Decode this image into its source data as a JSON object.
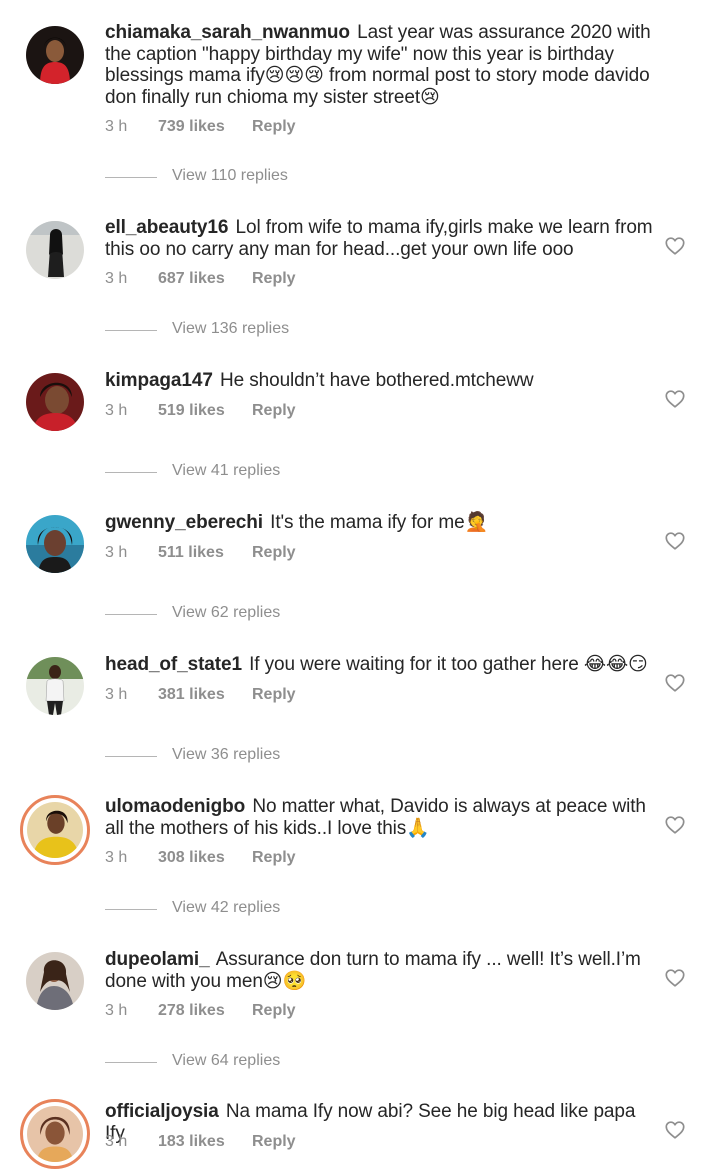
{
  "comments": [
    {
      "username": "chiamaka_sarah_nwanmuo",
      "text": "Last year was assurance 2020 with the caption \"happy birthday my wife\" now this year is birthday blessings mama ify😢😢😢 from normal post to story mode davido don finally run chioma my sister street😢",
      "time": "3 h",
      "likes": "739 likes",
      "reply": "Reply",
      "view_replies": "View 110 replies",
      "heart_visible": false
    },
    {
      "username": "ell_abeauty16",
      "text": "Lol from wife to mama ify,girls make we learn from this oo no carry any man for head...get your own life ooo",
      "time": "3 h",
      "likes": "687 likes",
      "reply": "Reply",
      "view_replies": "View 136 replies",
      "heart_visible": true
    },
    {
      "username": "kimpaga147",
      "text": "He shouldn’t have bothered.mtcheww",
      "time": "3 h",
      "likes": "519 likes",
      "reply": "Reply",
      "view_replies": "View 41 replies",
      "heart_visible": true
    },
    {
      "username": "gwenny_eberechi",
      "text": "It's the mama ify for me🤦",
      "time": "3 h",
      "likes": "511 likes",
      "reply": "Reply",
      "view_replies": "View 62 replies",
      "heart_visible": true
    },
    {
      "username": "head_of_state1",
      "text": "If you were waiting for it too gather here 😂😂😏",
      "time": "3 h",
      "likes": "381 likes",
      "reply": "Reply",
      "view_replies": "View 36 replies",
      "heart_visible": true
    },
    {
      "username": "ulomaodenigbo",
      "text": "No matter what, Davido is always at peace with all the mothers of his kids..I love this🙏",
      "time": "3 h",
      "likes": "308 likes",
      "reply": "Reply",
      "view_replies": "View 42 replies",
      "heart_visible": true,
      "story_ring": true
    },
    {
      "username": "dupeolami_",
      "text": "Assurance don turn to mama ify ... well! It’s well.I’m done with you men😢🥺",
      "time": "3 h",
      "likes": "278 likes",
      "reply": "Reply",
      "view_replies": "View 64 replies",
      "heart_visible": true
    },
    {
      "username": "officialjoysia",
      "text": "Na mama Ify now abi? See he big head like papa Ify",
      "time": "3 h",
      "likes": "183 likes",
      "reply": "Reply",
      "heart_visible": true,
      "story_ring": true
    }
  ],
  "colors": {
    "text": "#262626",
    "secondary": "#8e8e8e",
    "story_ring": "#e8835a"
  },
  "icons": [
    "heart-outline-icon",
    "avatar-icon"
  ]
}
